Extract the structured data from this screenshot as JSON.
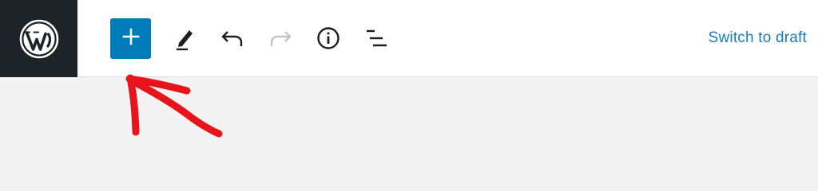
{
  "toolbar": {
    "logo_icon": "wordpress-logo-icon",
    "add_block_icon": "plus-icon",
    "tools_icon": "pencil-icon",
    "undo_icon": "undo-icon",
    "redo_icon": "redo-icon",
    "details_icon": "info-icon",
    "outline_icon": "list-view-icon",
    "switch_to_draft_label": "Switch to draft"
  },
  "colors": {
    "toolbar_bg": "#ffffff",
    "logo_bg": "#1e2327",
    "accent": "#007cba",
    "link": "#1a7bb9",
    "icon": "#1e1e1e",
    "icon_disabled": "#c3c4c7",
    "canvas_bg": "#f3f3f3",
    "annotation_arrow": "#e8141b"
  }
}
